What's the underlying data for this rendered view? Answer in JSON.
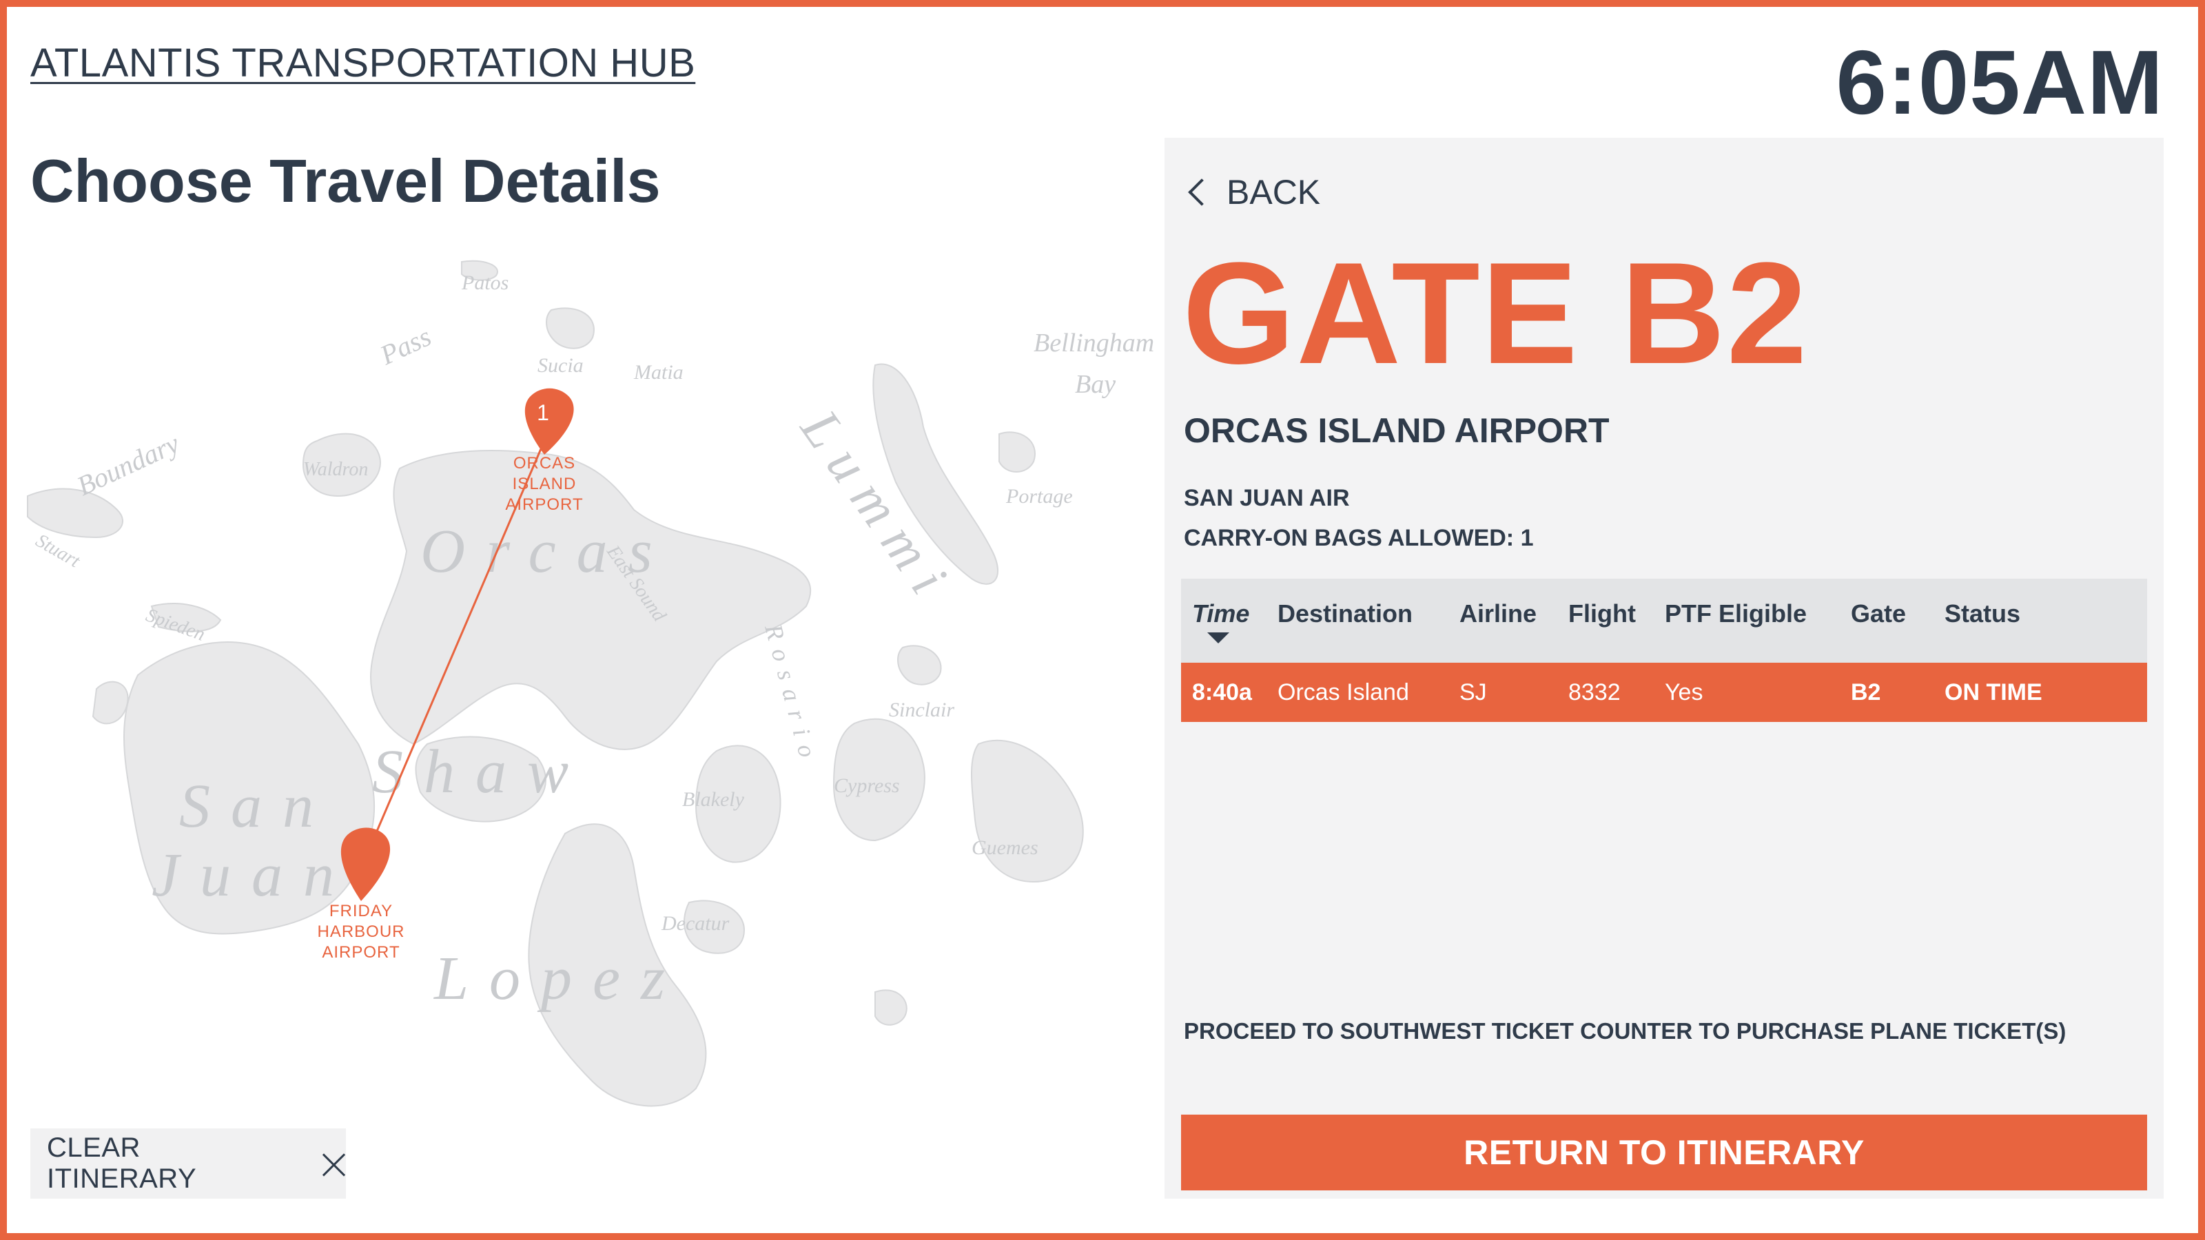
{
  "header": {
    "hub_title": "ATLANTIS TRANSPORTATION HUB",
    "time": "6:05AM"
  },
  "page": {
    "title": "Choose Travel Details"
  },
  "map": {
    "region_labels": [
      "Patos",
      "Sucia",
      "Matia",
      "Boundary",
      "Pass",
      "Waldron",
      "Stuart",
      "Spieden",
      "Orcas",
      "Shaw",
      "San",
      "Juan",
      "Lopez",
      "Lummi",
      "Bellingham",
      "Bay",
      "Portage",
      "Rosario",
      "Sinclair",
      "Cypress",
      "Blakely",
      "Guemes",
      "Decatur",
      "East Sound"
    ],
    "route": {
      "stop_number": "1",
      "origin_label_lines": [
        "FRIDAY",
        "HARBOUR",
        "AIRPORT"
      ],
      "destination_label_lines": [
        "ORCAS",
        "ISLAND",
        "AIRPORT"
      ]
    },
    "colors": {
      "land": "#e9e9ea",
      "accent": "#e8643f"
    }
  },
  "clear_itinerary": {
    "label": "CLEAR ITINERARY",
    "icon": "close-icon"
  },
  "detail": {
    "back_label": "BACK",
    "gate": "GATE B2",
    "airport": "ORCAS ISLAND AIRPORT",
    "airline": "SAN JUAN AIR",
    "bags": "CARRY-ON BAGS ALLOWED: 1",
    "table": {
      "headers": {
        "time": "Time",
        "destination": "Destination",
        "airline": "Airline",
        "flight": "Flight",
        "ptf": "PTF Eligible",
        "gate": "Gate",
        "status": "Status"
      },
      "rows": [
        {
          "time": "8:40a",
          "destination": "Orcas Island",
          "airline": "SJ",
          "flight": "8332",
          "ptf": "Yes",
          "gate": "B2",
          "status": "ON TIME"
        }
      ]
    },
    "notice": "PROCEED TO SOUTHWEST TICKET COUNTER TO PURCHASE PLANE TICKET(S)",
    "return_label": "RETURN TO ITINERARY"
  }
}
